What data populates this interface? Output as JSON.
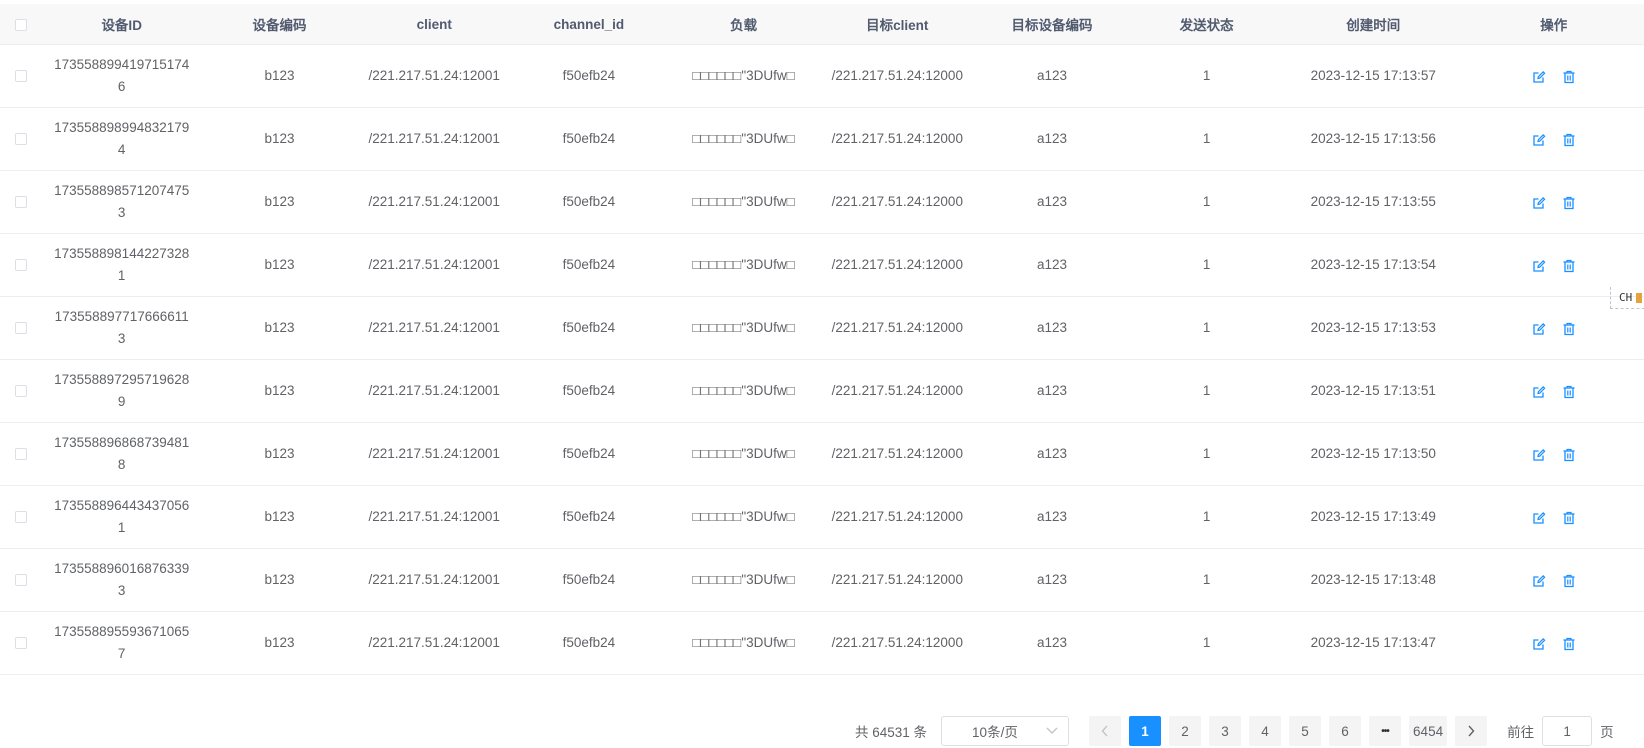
{
  "colors": {
    "accent": "#1890ff",
    "header_bg": "#f8f8f9",
    "border": "#ebeef5"
  },
  "table": {
    "headers": {
      "device_id": "设备ID",
      "device_code": "设备编码",
      "client": "client",
      "channel_id": "channel_id",
      "payload": "负载",
      "target_client": "目标client",
      "target_device_code": "目标设备编码",
      "send_status": "发送状态",
      "created_at": "创建时间",
      "actions": "操作"
    },
    "rows": [
      {
        "device_id": "1735588994197151746",
        "device_code": "b123",
        "client": "/221.217.51.24:12001",
        "channel_id": "f50efb24",
        "payload": "□□□□□□\"3DUfw□",
        "target_client": "/221.217.51.24:12000",
        "target_device_code": "a123",
        "send_status": "1",
        "created_at": "2023-12-15 17:13:57"
      },
      {
        "device_id": "1735588989948321794",
        "device_code": "b123",
        "client": "/221.217.51.24:12001",
        "channel_id": "f50efb24",
        "payload": "□□□□□□\"3DUfw□",
        "target_client": "/221.217.51.24:12000",
        "target_device_code": "a123",
        "send_status": "1",
        "created_at": "2023-12-15 17:13:56"
      },
      {
        "device_id": "1735588985712074753",
        "device_code": "b123",
        "client": "/221.217.51.24:12001",
        "channel_id": "f50efb24",
        "payload": "□□□□□□\"3DUfw□",
        "target_client": "/221.217.51.24:12000",
        "target_device_code": "a123",
        "send_status": "1",
        "created_at": "2023-12-15 17:13:55"
      },
      {
        "device_id": "1735588981442273281",
        "device_code": "b123",
        "client": "/221.217.51.24:12001",
        "channel_id": "f50efb24",
        "payload": "□□□□□□\"3DUfw□",
        "target_client": "/221.217.51.24:12000",
        "target_device_code": "a123",
        "send_status": "1",
        "created_at": "2023-12-15 17:13:54"
      },
      {
        "device_id": "1735588977176666113",
        "device_code": "b123",
        "client": "/221.217.51.24:12001",
        "channel_id": "f50efb24",
        "payload": "□□□□□□\"3DUfw□",
        "target_client": "/221.217.51.24:12000",
        "target_device_code": "a123",
        "send_status": "1",
        "created_at": "2023-12-15 17:13:53"
      },
      {
        "device_id": "1735588972957196289",
        "device_code": "b123",
        "client": "/221.217.51.24:12001",
        "channel_id": "f50efb24",
        "payload": "□□□□□□\"3DUfw□",
        "target_client": "/221.217.51.24:12000",
        "target_device_code": "a123",
        "send_status": "1",
        "created_at": "2023-12-15 17:13:51"
      },
      {
        "device_id": "1735588968687394818",
        "device_code": "b123",
        "client": "/221.217.51.24:12001",
        "channel_id": "f50efb24",
        "payload": "□□□□□□\"3DUfw□",
        "target_client": "/221.217.51.24:12000",
        "target_device_code": "a123",
        "send_status": "1",
        "created_at": "2023-12-15 17:13:50"
      },
      {
        "device_id": "1735588964434370561",
        "device_code": "b123",
        "client": "/221.217.51.24:12001",
        "channel_id": "f50efb24",
        "payload": "□□□□□□\"3DUfw□",
        "target_client": "/221.217.51.24:12000",
        "target_device_code": "a123",
        "send_status": "1",
        "created_at": "2023-12-15 17:13:49"
      },
      {
        "device_id": "1735588960168763393",
        "device_code": "b123",
        "client": "/221.217.51.24:12001",
        "channel_id": "f50efb24",
        "payload": "□□□□□□\"3DUfw□",
        "target_client": "/221.217.51.24:12000",
        "target_device_code": "a123",
        "send_status": "1",
        "created_at": "2023-12-15 17:13:48"
      },
      {
        "device_id": "1735588955936710657",
        "device_code": "b123",
        "client": "/221.217.51.24:12001",
        "channel_id": "f50efb24",
        "payload": "□□□□□□\"3DUfw□",
        "target_client": "/221.217.51.24:12000",
        "target_device_code": "a123",
        "send_status": "1",
        "created_at": "2023-12-15 17:13:47"
      }
    ],
    "row_actions": {
      "edit_icon": "edit-icon",
      "delete_icon": "delete-icon"
    }
  },
  "ime_tag": {
    "label": "CH"
  },
  "pagination": {
    "total": "共 64531 条",
    "page_size": "10条/页",
    "pages": [
      "1",
      "2",
      "3",
      "4",
      "5",
      "6"
    ],
    "ellipsis": "•••",
    "last_page": "6454",
    "current": "1",
    "goto_prefix": "前往",
    "goto_value": "1",
    "goto_suffix": "页"
  }
}
